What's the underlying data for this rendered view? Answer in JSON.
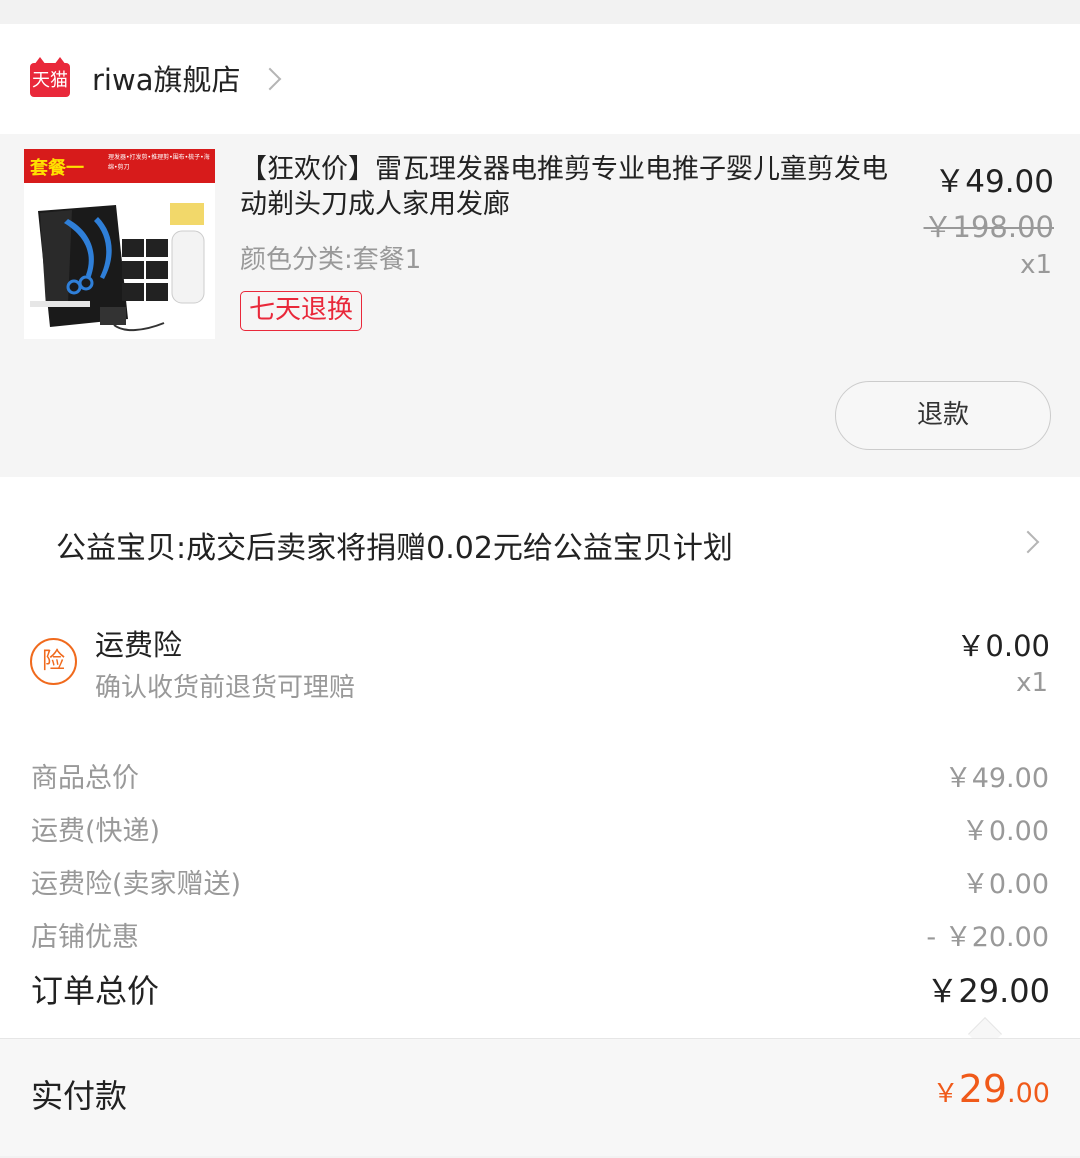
{
  "shop": {
    "badge": "天猫",
    "name": "riwa旗舰店"
  },
  "product": {
    "thumb_title": "套餐一",
    "thumb_sub": "理发器•打发剪•推理剪•围布•梳子•海绵•剪刀",
    "title": "【狂欢价】雷瓦理发器电推剪专业电推子婴儿童剪发电动剃头刀成人家用发廊",
    "sku": "颜色分类:套餐1",
    "badge": "七天退换",
    "price": "￥49.00",
    "original_price": "￥198.00",
    "quantity": "x1",
    "refund_label": "退款"
  },
  "charity": {
    "text": "公益宝贝:成交后卖家将捐赠0.02元给公益宝贝计划"
  },
  "insurance": {
    "icon_char": "险",
    "title": "运费险",
    "desc": "确认收货前退货可理赔",
    "price": "￥0.00",
    "quantity": "x1"
  },
  "summary": {
    "rows": [
      {
        "label": "商品总价",
        "value": "￥49.00"
      },
      {
        "label": "运费(快递)",
        "value": "￥0.00"
      },
      {
        "label": "运费险(卖家赠送)",
        "value": "￥0.00"
      },
      {
        "label": "店铺优惠",
        "value": "- ￥20.00"
      }
    ],
    "total_label": "订单总价",
    "total_value": "￥29.00"
  },
  "payment": {
    "label": "实付款",
    "currency": "￥",
    "amount_int": "29",
    "amount_dec": ".00"
  },
  "colors": {
    "brand_red": "#e9283a",
    "accent_orange": "#f05a1a"
  }
}
